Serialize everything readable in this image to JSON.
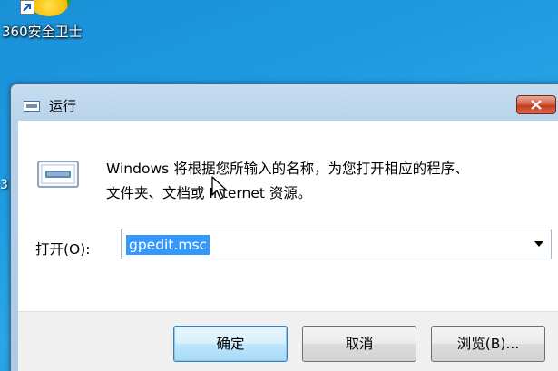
{
  "desktop": {
    "icon_label": "360安全卫士",
    "edge_text": "3"
  },
  "dialog": {
    "title": "运行",
    "description_line1": "Windows 将根据您所输入的名称，为您打开相应的程序、",
    "description_line2": "文件夹、文档或 Internet 资源。",
    "open_label": "打开(O):",
    "open_value": "gpedit.msc",
    "buttons": {
      "ok": "确定",
      "cancel": "取消",
      "browse": "浏览(B)..."
    }
  },
  "icons": {
    "desktop": "360-security-icon",
    "shortcut": "shortcut-arrow-icon",
    "title": "run-window-icon",
    "close": "close-icon",
    "run": "run-program-icon",
    "dropdown": "chevron-down-icon",
    "cursor": "mouse-pointer-icon"
  },
  "colors": {
    "desktop_bg": "#1e9be2",
    "selection": "#3399ff",
    "close_button": "#c23c1f",
    "default_button_border": "#3c7fb1"
  }
}
